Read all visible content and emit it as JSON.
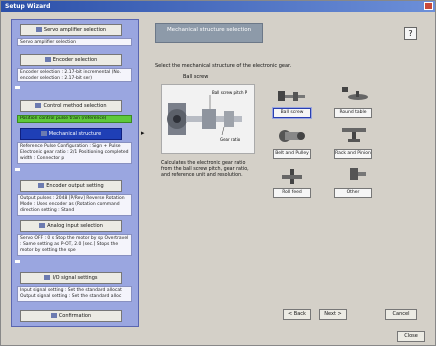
{
  "window": {
    "title": "Setup Wizard"
  },
  "steps": {
    "servo_amp": {
      "label": "Servo amplifier selection"
    },
    "servo_amp_info": "Servo amplifier selection",
    "encoder": {
      "label": "Encoder selection"
    },
    "encoder_info": "Encoder selection : 2.17-bit incremental (No. encoder selection : 2.17-bit ser)",
    "mechanism": {
      "label": "Control method selection"
    },
    "mechanism_info": "Position control pulse train (reference)",
    "ref_config": {
      "label": "Mechanical structure"
    },
    "ref_config_info": "Reference Pulse Configuration : Sign + Pulse  Electronic gear ratio : 2/1  Positioning completed width : Connector p",
    "encoder_output": {
      "label": "Encoder output setting"
    },
    "encoder_output_info": "Output pulses : 2048 [P/Rev]  Reverse Rotation Mode : Uses encoder as  (Rotation command direction setting : Stand",
    "analog": {
      "label": "Analog input selection"
    },
    "analog_info": "Servo OFF : 0 s Stop the motor by sp  Overtravel : Same setting as P-OT, 2.0 [sec.]  Stops the motor by setting the spe",
    "io_signals": {
      "label": "I/O signal settings"
    },
    "io_signals_info": "Input signal setting : Set the standard allocat  Output signal setting : Set the standard alloc",
    "confirm": {
      "label": "Confirmation"
    }
  },
  "content": {
    "header": "Mechanical structure selection",
    "help_label": "?",
    "instruction": "Select the mechanical structure of the electronic gear.",
    "ballscrew_title": "Ball screw",
    "diagram_labels": {
      "pitch": "Ball screw pitch P",
      "ratio": "Gear ratio"
    },
    "description": "Calculates the electronic gear ratio from the ball screw pitch, gear ratio, and reference unit and resolution."
  },
  "options": [
    {
      "label": "Ball screw"
    },
    {
      "label": "Round table"
    },
    {
      "label": "Belt and Pulley"
    },
    {
      "label": "Rack and Pinion"
    },
    {
      "label": "Roll feed"
    },
    {
      "label": "Other"
    }
  ],
  "nav": {
    "back": "< Back",
    "next": "Next >",
    "cancel": "Cancel",
    "close": "Close"
  }
}
